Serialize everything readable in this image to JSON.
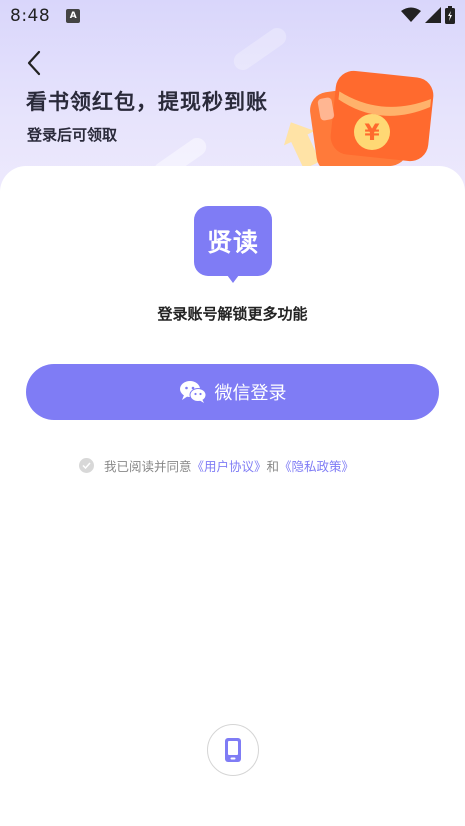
{
  "status_bar": {
    "time": "8:48",
    "app_badge": "A"
  },
  "header": {
    "headline": "看书领红包，提现秒到账",
    "subline": "登录后可领取",
    "redpacket_symbol": "¥"
  },
  "logo": {
    "text": "贤读"
  },
  "tagline": "登录账号解锁更多功能",
  "wechat_login": {
    "label": "微信登录"
  },
  "agreement": {
    "prefix": "我已阅读并同意",
    "user_agreement": "《用户协议》",
    "joiner": "和",
    "privacy_policy": "《隐私政策》"
  },
  "colors": {
    "accent": "#7f7cf5",
    "header_bg": "#dcd9fb",
    "redpacket": "#ff6a2e"
  }
}
